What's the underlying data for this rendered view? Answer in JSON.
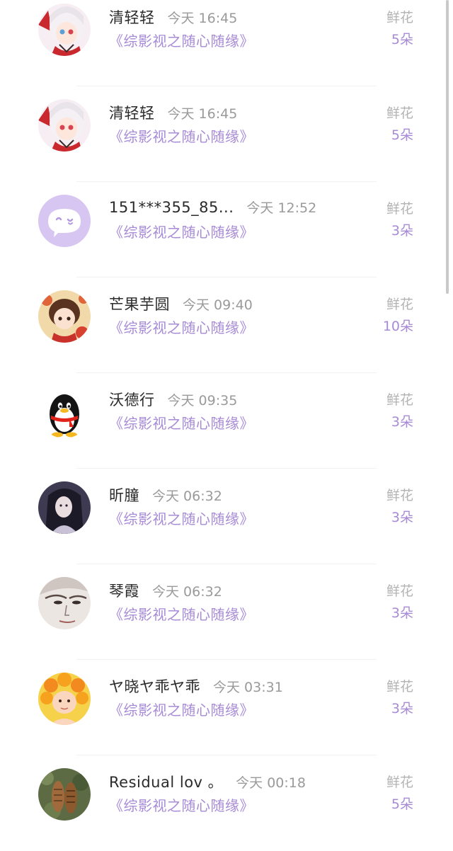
{
  "list": {
    "items": [
      {
        "name": "清轻轻",
        "time": "今天 16:45",
        "book": "《综影视之随心随缘》",
        "gift_label": "鲜花",
        "gift_count": "5朵",
        "avatar": "anime-girl-avatar"
      },
      {
        "name": "清轻轻",
        "time": "今天 16:45",
        "book": "《综影视之随心随缘》",
        "gift_label": "鲜花",
        "gift_count": "5朵",
        "avatar": "anime-girl-avatar"
      },
      {
        "name": "151***355_85...",
        "time": "今天 12:52",
        "book": "《综影视之随心随缘》",
        "gift_label": "鲜花",
        "gift_count": "3朵",
        "avatar": "default-chat-avatar"
      },
      {
        "name": "芒果芋圆",
        "time": "今天 09:40",
        "book": "《综影视之随心随缘》",
        "gift_label": "鲜花",
        "gift_count": "10朵",
        "avatar": "illustrated-girl-avatar"
      },
      {
        "name": "沃德行",
        "time": "今天 09:35",
        "book": "《综影视之随心随缘》",
        "gift_label": "鲜花",
        "gift_count": "3朵",
        "avatar": "penguin-avatar"
      },
      {
        "name": "昕朣",
        "time": "今天 06:32",
        "book": "《综影视之随心随缘》",
        "gift_label": "鲜花",
        "gift_count": "3朵",
        "avatar": "dark-hair-portrait-avatar"
      },
      {
        "name": "琴霞",
        "time": "今天 06:32",
        "book": "《综影视之随心随缘》",
        "gift_label": "鲜花",
        "gift_count": "3朵",
        "avatar": "sketch-portrait-avatar"
      },
      {
        "name": "ヤ晓ヤ乖ヤ乖",
        "time": "今天 03:31",
        "book": "《综影视之随心随缘》",
        "gift_label": "鲜花",
        "gift_count": "3朵",
        "avatar": "baby-flower-avatar"
      },
      {
        "name": "Residual lov 。",
        "time": "今天 00:18",
        "book": "《综影视之随心随缘》",
        "gift_label": "鲜花",
        "gift_count": "5朵",
        "avatar": "shoes-photo-avatar"
      }
    ]
  },
  "colors": {
    "accent": "#a78bd6",
    "name": "#2b2b2b",
    "time": "#9a9a9a",
    "gift_label": "#b3b3b3"
  }
}
